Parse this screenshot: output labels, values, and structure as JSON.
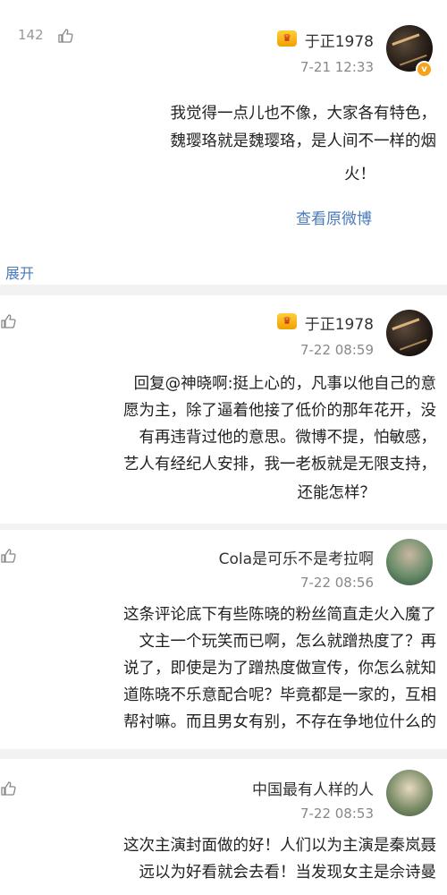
{
  "comment1": {
    "user": "于正1978",
    "time": "7-21 12:33",
    "likes": "142",
    "lines": [
      "我觉得一点儿也不像，大家各有特色，",
      "魏璎珞就是魏璎珞，是人间不一样的烟",
      "火！"
    ],
    "link": "查看原微博"
  },
  "expand_label": "展开",
  "comment2": {
    "user": "于正1978",
    "time": "7-22 08:59",
    "lines": [
      "回复@神晓啊:挺上心的，凡事以他自己的意",
      "愿为主，除了逼着他接了低价的那年花开，没",
      "有再违背过他的意思。微博不提，怕敏感，",
      "艺人有经纪人安排，我一老板就是无限支持，",
      "还能怎样？"
    ]
  },
  "comment3": {
    "user": "Cola是可乐不是考拉啊",
    "time": "7-22 08:56",
    "lines": [
      "这条评论底下有些陈晓的粉丝简直走火入魔了",
      "文主一个玩笑而已啊，怎么就蹭热度了？再",
      "说了，即使是为了蹭热度做宣传，你怎么就知",
      "道陈晓不乐意配合呢？毕竟都是一家的，互相",
      "帮衬嘛。而且男女有别，不存在争地位什么的"
    ]
  },
  "comment4": {
    "user": "中国最有人样的人",
    "time": "7-22 08:53",
    "lines": [
      "这次主演封面做的好！人们以为主演是秦岚聂",
      "远以为好看就会去看！当发现女主是佘诗曼"
    ]
  }
}
